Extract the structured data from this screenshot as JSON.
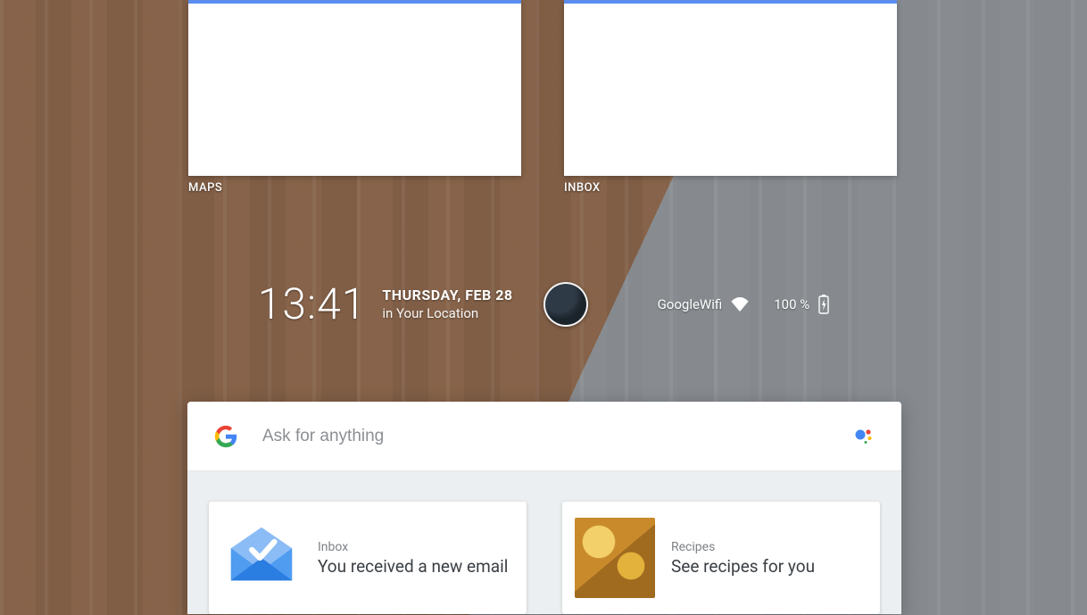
{
  "widgets": [
    {
      "label": "MAPS"
    },
    {
      "label": "INBOX"
    }
  ],
  "clock": {
    "time": "13:41",
    "date": "THURSDAY, FEB 28",
    "location_prefix": "in ",
    "location": "Your Location"
  },
  "status": {
    "wifi_name": "GoogleWifi",
    "battery_pct": "100 %"
  },
  "search": {
    "placeholder": "Ask for anything"
  },
  "feed": [
    {
      "kicker": "Inbox",
      "headline": "You received a new email"
    },
    {
      "kicker": "Recipes",
      "headline": "See recipes for you"
    }
  ]
}
